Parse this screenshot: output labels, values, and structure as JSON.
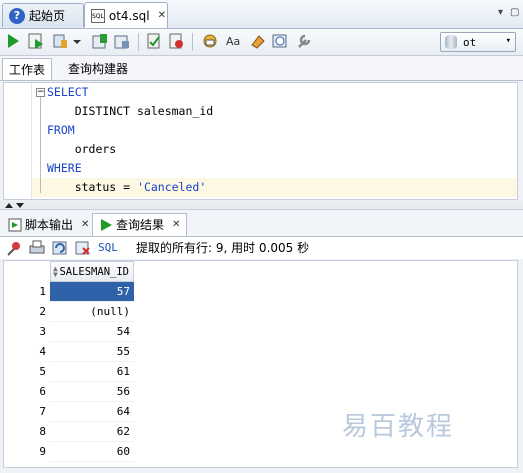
{
  "doc_tabs": [
    {
      "label": "起始页",
      "icon": "help-icon",
      "active": false
    },
    {
      "label": "ot4.sql",
      "icon": "sql-file-icon",
      "active": true
    }
  ],
  "toolbar": {
    "connection": "ot"
  },
  "sub_tabs": [
    {
      "label": "工作表",
      "active": true
    },
    {
      "label": "查询构建器",
      "active": false
    }
  ],
  "editor": {
    "lines": [
      {
        "keyword": "SELECT",
        "text": ""
      },
      {
        "keyword": "",
        "text": "    DISTINCT salesman_id"
      },
      {
        "keyword": "FROM",
        "text": ""
      },
      {
        "keyword": "",
        "text": "    orders"
      },
      {
        "keyword": "WHERE",
        "text": ""
      },
      {
        "keyword": "",
        "text": "    status = ",
        "string": "'Canceled'"
      }
    ]
  },
  "output_tabs": [
    {
      "label": "脚本输出",
      "active": false
    },
    {
      "label": "查询结果",
      "active": true
    }
  ],
  "result_toolbar": {
    "sql_label": "SQL",
    "status": "提取的所有行: 9, 用时 0.005 秒"
  },
  "grid": {
    "column": "SALESMAN_ID",
    "rows": [
      {
        "n": "1",
        "v": "57"
      },
      {
        "n": "2",
        "v": "(null)"
      },
      {
        "n": "3",
        "v": "54"
      },
      {
        "n": "4",
        "v": "55"
      },
      {
        "n": "5",
        "v": "61"
      },
      {
        "n": "6",
        "v": "56"
      },
      {
        "n": "7",
        "v": "64"
      },
      {
        "n": "8",
        "v": "62"
      },
      {
        "n": "9",
        "v": "60"
      }
    ]
  },
  "watermark": "易百教程",
  "colors": {
    "accent": "#2f62a8",
    "keyword": "#1a43c8"
  }
}
